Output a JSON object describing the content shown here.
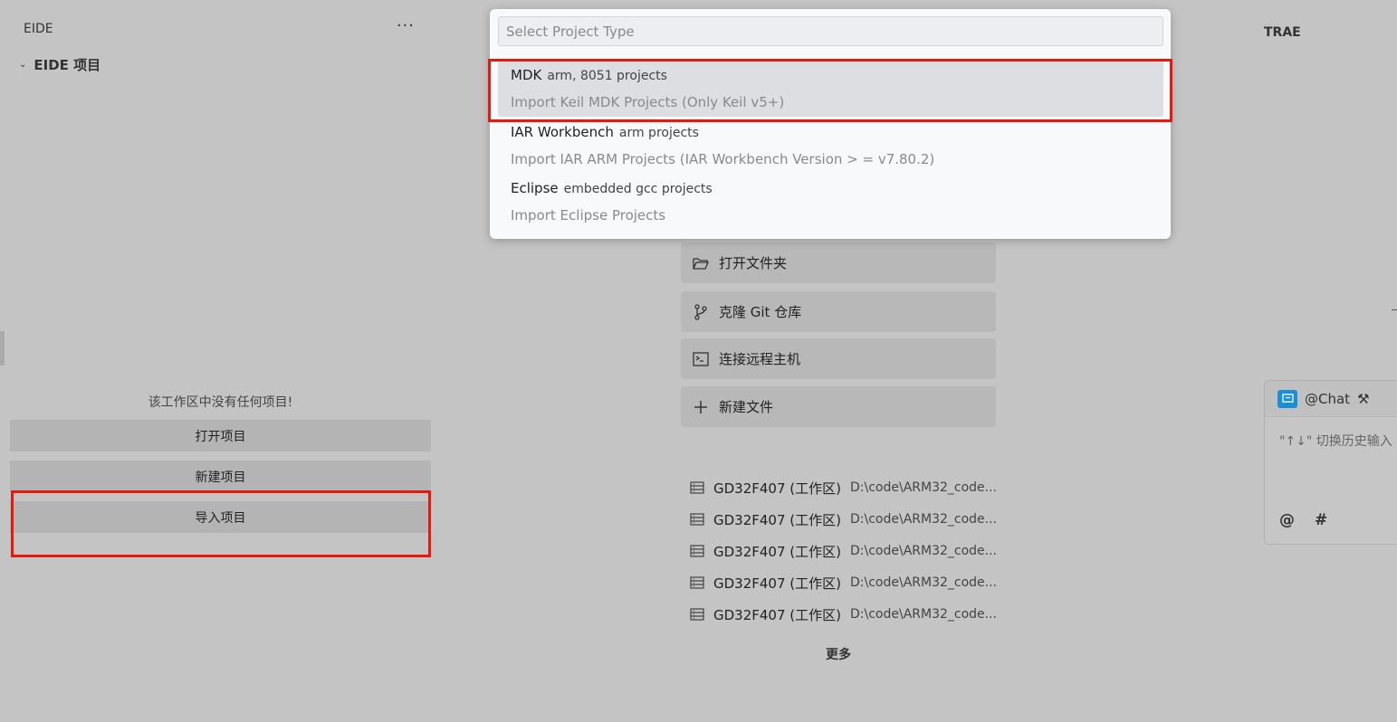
{
  "left_panel": {
    "title": "EIDE",
    "more": "···",
    "section_title": "EIDE 项目",
    "empty_text": "该工作区中没有任何项目!",
    "buttons": {
      "open": "打开项目",
      "new": "新建项目",
      "import": "导入项目"
    }
  },
  "center_panel": {
    "actions": {
      "open_folder": "打开文件夹",
      "clone_git": "克隆 Git 仓库",
      "connect_remote": "连接远程主机",
      "new_file": "新建文件"
    },
    "recent": [
      {
        "name": "GD32F407 (工作区)",
        "path": "D:\\code\\ARM32_code..."
      },
      {
        "name": "GD32F407 (工作区)",
        "path": "D:\\code\\ARM32_code..."
      },
      {
        "name": "GD32F407 (工作区)",
        "path": "D:\\code\\ARM32_code..."
      },
      {
        "name": "GD32F407 (工作区)",
        "path": "D:\\code\\ARM32_code..."
      },
      {
        "name": "GD32F407 (工作区)",
        "path": "D:\\code\\ARM32_code..."
      }
    ],
    "more": "更多"
  },
  "right_panel": {
    "title": "TRAE",
    "chat_label": "@Chat",
    "chat_placeholder": "\"↑↓\" 切换历史输入",
    "tools": {
      "at": "@",
      "hash": "#"
    }
  },
  "quickpick": {
    "placeholder": "Select Project Type",
    "items": [
      {
        "label": "MDK",
        "description": "arm, 8051 projects",
        "detail": "Import Keil MDK Projects (Only Keil v5+)"
      },
      {
        "label": "IAR Workbench",
        "description": "arm projects",
        "detail": "Import IAR ARM Projects (IAR Workbench Version > = v7.80.2)"
      },
      {
        "label": "Eclipse",
        "description": "embedded gcc projects",
        "detail": "Import Eclipse Projects"
      }
    ]
  },
  "colors": {
    "highlight_border": "#e8180f",
    "chat_badge": "#1a8fd8"
  }
}
